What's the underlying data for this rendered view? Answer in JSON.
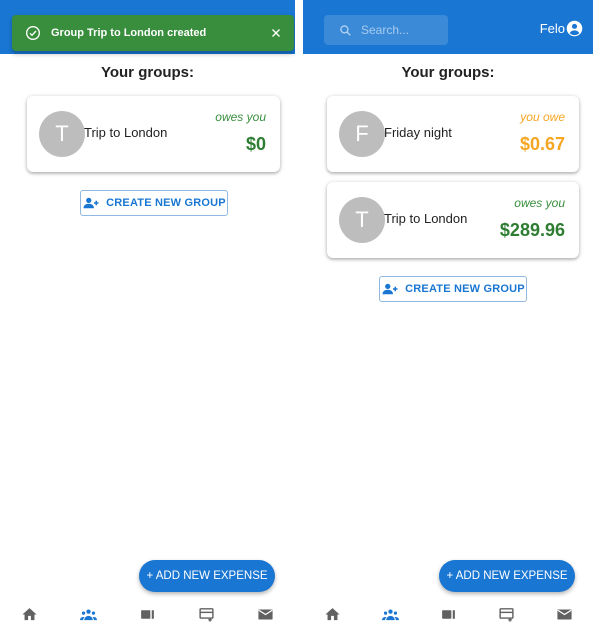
{
  "colors": {
    "primary": "#1976d2",
    "snackbar_success": "#388e3c",
    "owes_you": "#388e3c",
    "you_owe": "#f5a623",
    "avatar_bg": "#bdbdbd"
  },
  "left_screen": {
    "snackbar": {
      "icon": "check-circle-icon",
      "message": "Group Trip to London created",
      "close_icon": "close-icon"
    },
    "heading": "Your groups:",
    "groups": [
      {
        "initial": "T",
        "name": "Trip to London",
        "status": "owes you",
        "amount": "$0"
      }
    ],
    "create_group_label": "CREATE NEW GROUP",
    "add_expense_label": "+ ADD NEW EXPENSE",
    "bottom_nav": [
      {
        "icon": "home-icon",
        "active": false
      },
      {
        "icon": "groups-icon",
        "active": true
      },
      {
        "icon": "friends-icon",
        "active": false
      },
      {
        "icon": "activity-icon",
        "active": false
      },
      {
        "icon": "mail-icon",
        "active": false
      }
    ]
  },
  "right_screen": {
    "search_placeholder": "Search...",
    "user_name": "Felo",
    "heading": "Your groups:",
    "groups": [
      {
        "initial": "F",
        "name": "Friday night",
        "status": "you owe",
        "amount": "$0.67"
      },
      {
        "initial": "T",
        "name": "Trip to London",
        "status": "owes you",
        "amount": "$289.96"
      }
    ],
    "create_group_label": "CREATE NEW GROUP",
    "add_expense_label": "+ ADD NEW EXPENSE",
    "bottom_nav": [
      {
        "icon": "home-icon",
        "active": false
      },
      {
        "icon": "groups-icon",
        "active": true
      },
      {
        "icon": "friends-icon",
        "active": false
      },
      {
        "icon": "activity-icon",
        "active": false
      },
      {
        "icon": "mail-icon",
        "active": false
      }
    ]
  }
}
